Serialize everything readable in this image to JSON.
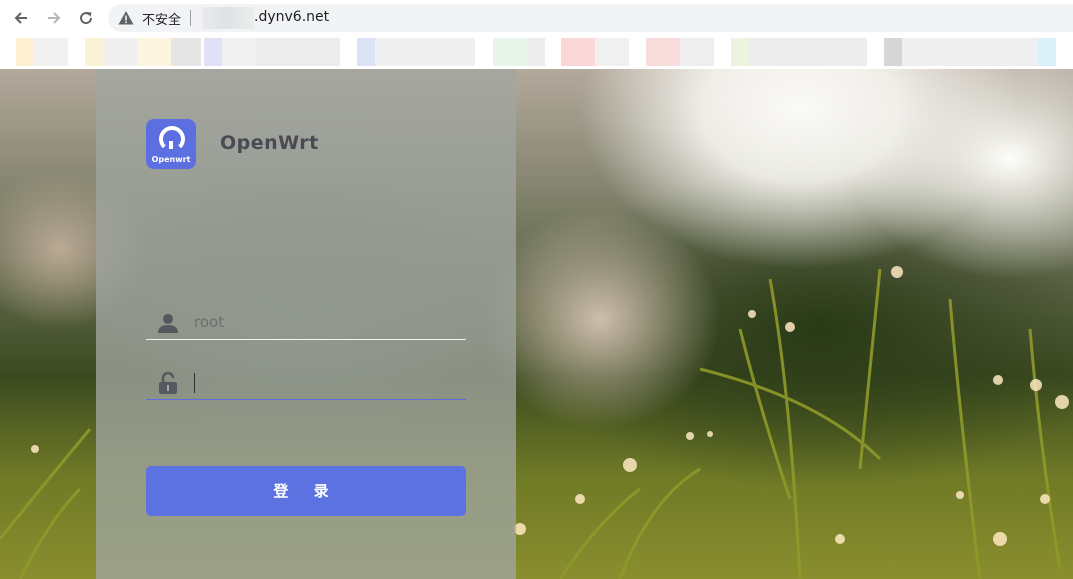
{
  "browser": {
    "address_bar": {
      "security_label": "不安全",
      "url_visible": ".dynv6.net"
    },
    "icons": {
      "back": "arrow-left-icon",
      "forward": "arrow-right-icon",
      "reload": "reload-icon",
      "security": "warning-triangle-icon"
    }
  },
  "login": {
    "brand": "OpenWrt",
    "logo_text": "Openwrt",
    "username": {
      "value": "",
      "placeholder": "root"
    },
    "password": {
      "value": ""
    },
    "submit_label": "登 录",
    "colors": {
      "accent": "#5b72e0",
      "logo_bg": "#5b6fe0"
    }
  }
}
